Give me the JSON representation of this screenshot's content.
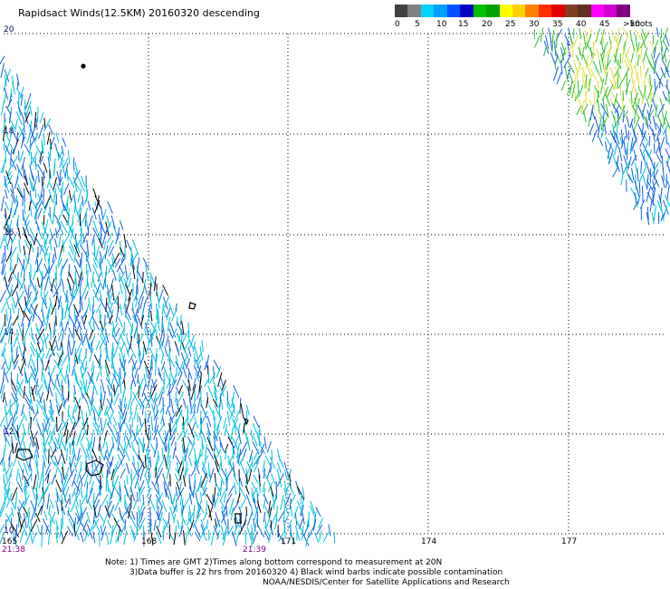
{
  "title": "Rapidsact Winds(12.5KM) 20160320 descending",
  "legend": {
    "colors": [
      "#404040",
      "#808080",
      "#00d0ff",
      "#00a0ff",
      "#0050ff",
      "#0000c0",
      "#00c000",
      "#00a000",
      "#ffff00",
      "#ffd000",
      "#ff8000",
      "#ff3000",
      "#e00000",
      "#804020",
      "#603020",
      "#ff00ff",
      "#d000d0",
      "#800080"
    ],
    "labels": [
      "0",
      "5",
      "10",
      "15",
      "20",
      "25",
      "30",
      "35",
      "40",
      "45",
      ">50"
    ],
    "units": "knots"
  },
  "lat_labels": [
    "20",
    "18",
    "16",
    "14",
    "12",
    "10"
  ],
  "lon_labels": [
    "165",
    "168",
    "171",
    "174",
    "177"
  ],
  "time_labels": [
    "21:38",
    "21:39"
  ],
  "notes": {
    "line1": "Note: 1) Times are GMT 2)Times along bottom correspond to measurement at 20N",
    "line2": "3)Data buffer is 22 hrs from 20160320 4) Black wind barbs indicate possible contamination",
    "line3": "NOAA/NESDIS/Center for Satellite Applications and Research"
  },
  "colors": {
    "grid": "#000000",
    "barb_low": "#00c0e0",
    "barb_mid": "#1060e0",
    "barb_contaminated": "#000000",
    "barb_green": "#30c030",
    "barb_yellow": "#e0e040"
  }
}
